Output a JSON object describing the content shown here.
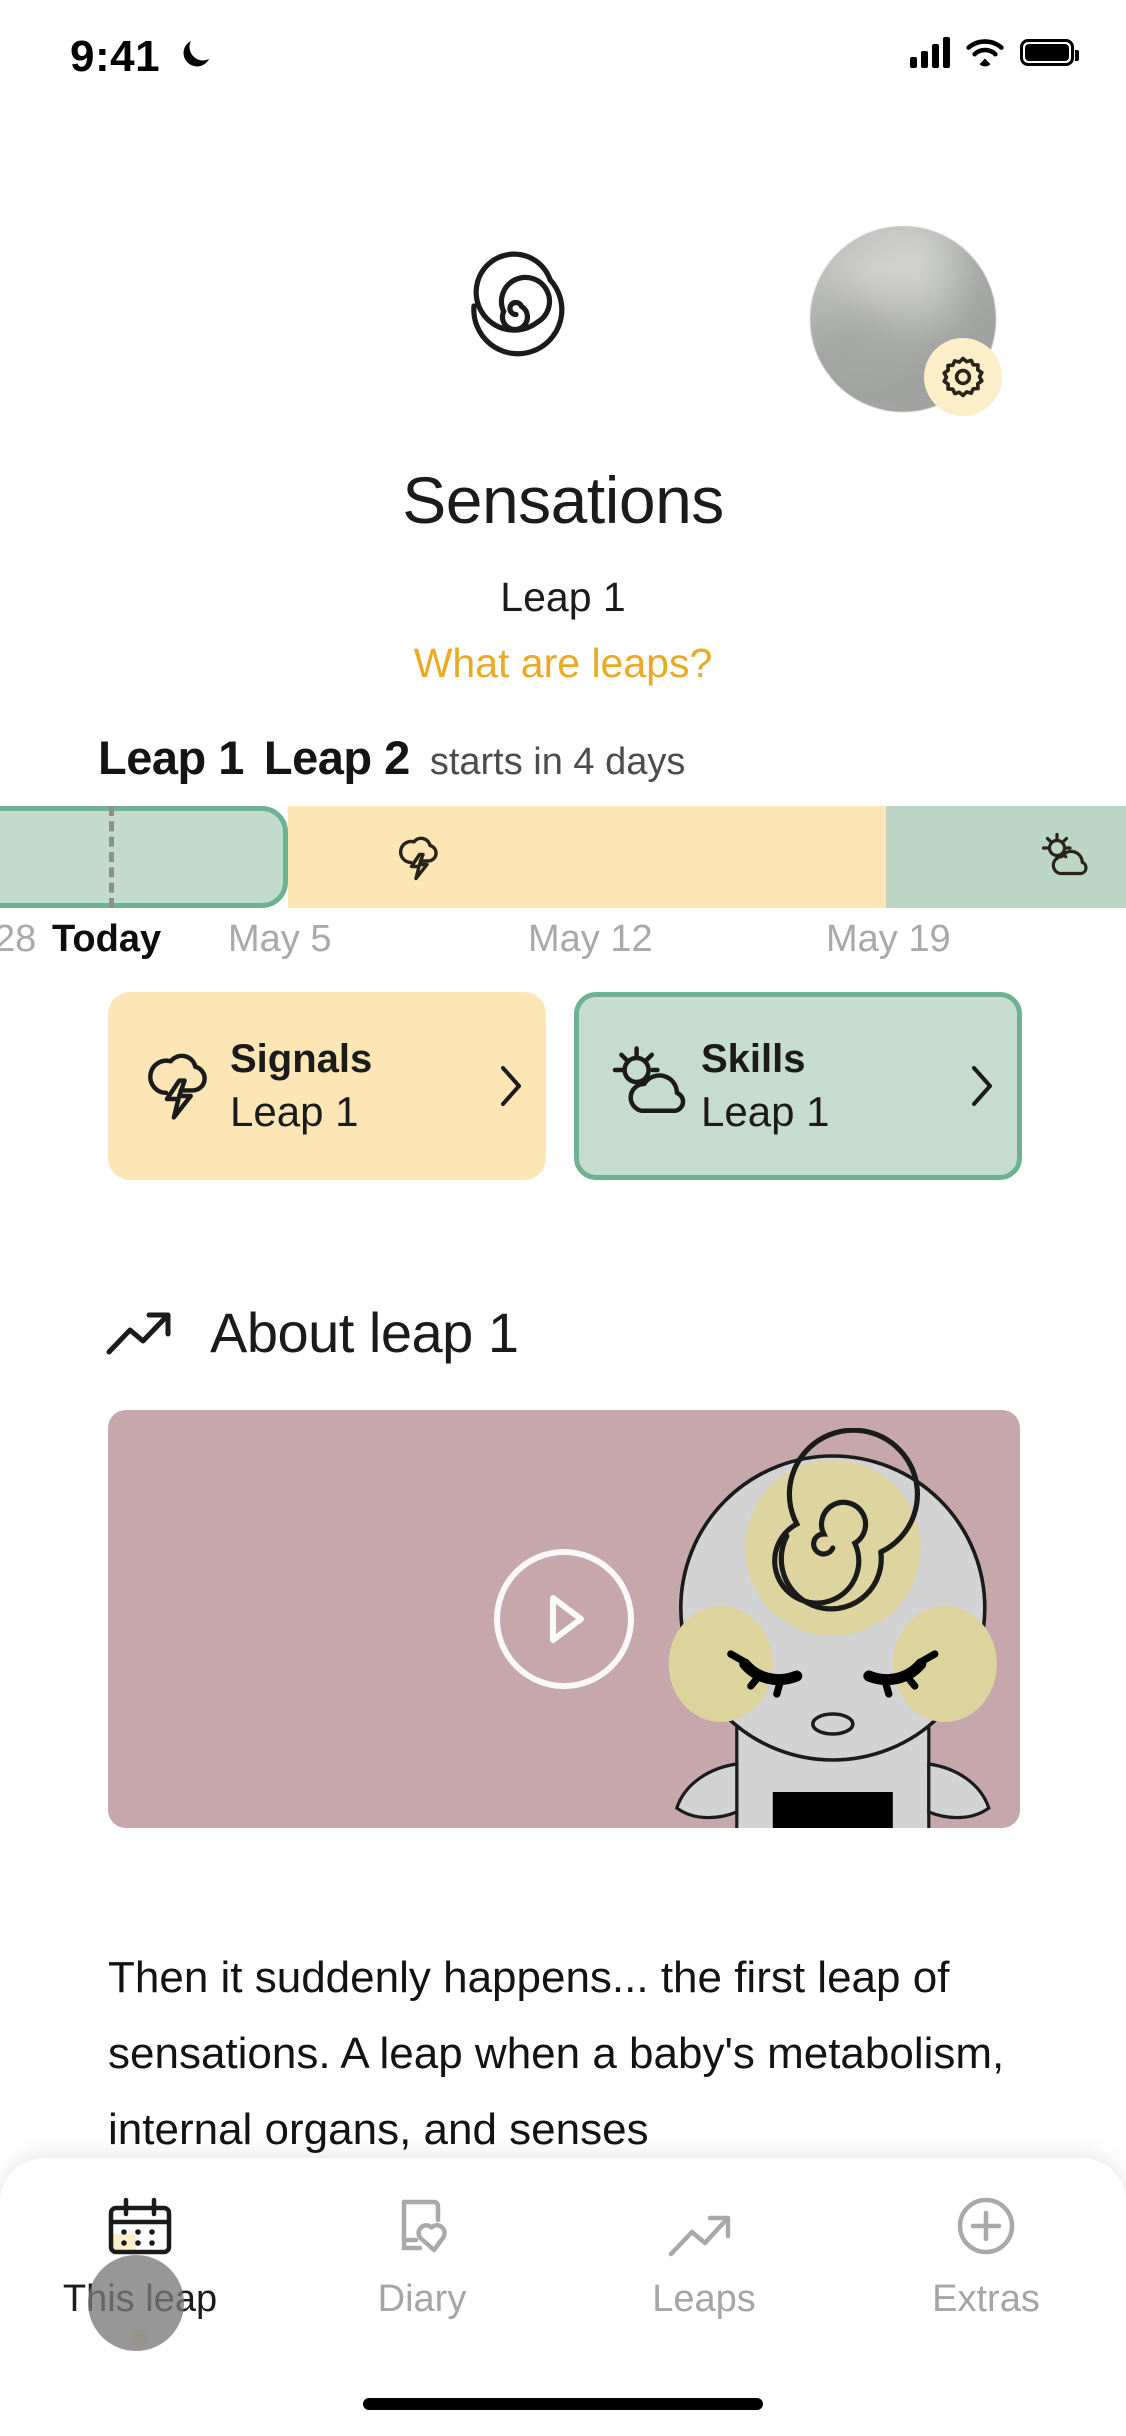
{
  "status_bar": {
    "time": "9:41",
    "dnd_icon": "moon-icon",
    "signal_icon": "cellular-signal-icon",
    "wifi_icon": "wifi-icon",
    "battery_icon": "battery-full-icon"
  },
  "header": {
    "logo_icon": "spiral-logo-icon",
    "avatar_label": "profile-avatar",
    "settings_icon": "gear-icon",
    "title": "Sensations",
    "subtitle": "Leap 1",
    "link": "What are leaps?",
    "link_color": "#eaaa23"
  },
  "timeline": {
    "current_leap_label": "Leap 1",
    "next_leap_label": "Leap 2",
    "next_leap_status": "starts in 4 days",
    "segments": [
      {
        "name": "leap-1-active",
        "color": "#c3dbcd",
        "border_color": "#6eb295",
        "icon": ""
      },
      {
        "name": "leap-2-upcoming",
        "color": "#fce6b6",
        "icon": "storm-cloud-icon"
      },
      {
        "name": "leap-3-sunny",
        "color": "#bcd6c6",
        "icon": "sun-cloud-icon"
      }
    ],
    "dates": [
      {
        "label": "28",
        "today": false
      },
      {
        "label": "Today",
        "today": true
      },
      {
        "label": "May 5",
        "today": false
      },
      {
        "label": "May 12",
        "today": false
      },
      {
        "label": "May 19",
        "today": false
      }
    ]
  },
  "cards": [
    {
      "name": "signals",
      "icon": "storm-cloud-icon",
      "title": "Signals",
      "subtitle": "Leap 1",
      "chevron": "chevron-right-icon",
      "bg": "#fce6b6",
      "selected": false
    },
    {
      "name": "skills",
      "icon": "sun-cloud-icon",
      "title": "Skills",
      "subtitle": "Leap 1",
      "chevron": "chevron-right-icon",
      "bg": "#c5dccf",
      "selected": true
    }
  ],
  "about": {
    "icon": "trending-up-icon",
    "heading": "About leap 1",
    "video": {
      "play_icon": "play-circle-icon",
      "thumbnail": "baby-illustration",
      "bg": "#c6a7ab"
    },
    "paragraph": "Then it suddenly happens... the first leap of sensations. A leap when a baby's metabolism, internal organs, and senses"
  },
  "tab_bar": {
    "items": [
      {
        "name": "this-leap",
        "icon": "calendar-icon",
        "label": "This leap",
        "active": true
      },
      {
        "name": "diary",
        "icon": "diary-heart-icon",
        "label": "Diary",
        "active": false
      },
      {
        "name": "leaps",
        "icon": "trending-up-icon",
        "label": "Leaps",
        "active": false
      },
      {
        "name": "extras",
        "icon": "plus-circle-icon",
        "label": "Extras",
        "active": false
      }
    ]
  }
}
